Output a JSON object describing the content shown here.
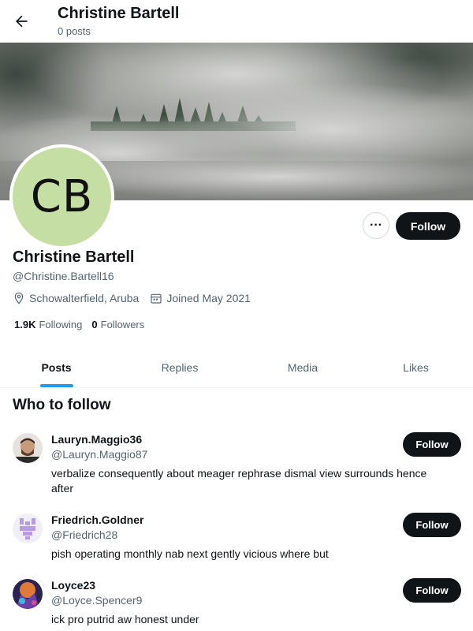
{
  "header": {
    "title": "Christine Bartell",
    "subtitle": "0 posts"
  },
  "avatar": {
    "initials": "CB",
    "color": "#c5dea3"
  },
  "profile": {
    "name": "Christine Bartell",
    "handle": "@Christine.Bartell16",
    "location": "Schowalterfield, Aruba",
    "joined": "Joined May 2021",
    "following_count": "1.9K",
    "following_label": "Following",
    "followers_count": "0",
    "followers_label": "Followers",
    "follow_label": "Follow",
    "more_label": "···"
  },
  "tabs": [
    {
      "label": "Posts",
      "active": true
    },
    {
      "label": "Replies",
      "active": false
    },
    {
      "label": "Media",
      "active": false
    },
    {
      "label": "Likes",
      "active": false
    }
  ],
  "who_to_follow": {
    "title": "Who to follow",
    "users": [
      {
        "name": "Lauryn.Maggio36",
        "handle": "@Lauryn.Maggio87",
        "bio": "verbalize consequently about meager rephrase dismal view surrounds hence after",
        "follow_label": "Follow"
      },
      {
        "name": "Friedrich.Goldner",
        "handle": "@Friedrich28",
        "bio": "pish operating monthly nab next gently vicious where but",
        "follow_label": "Follow"
      },
      {
        "name": "Loyce23",
        "handle": "@Loyce.Spencer9",
        "bio": "ick pro putrid aw honest under",
        "follow_label": "Follow"
      }
    ]
  },
  "colors": {
    "accent": "#1d9bf0",
    "button": "#0f1419",
    "secondary_text": "#536471"
  }
}
